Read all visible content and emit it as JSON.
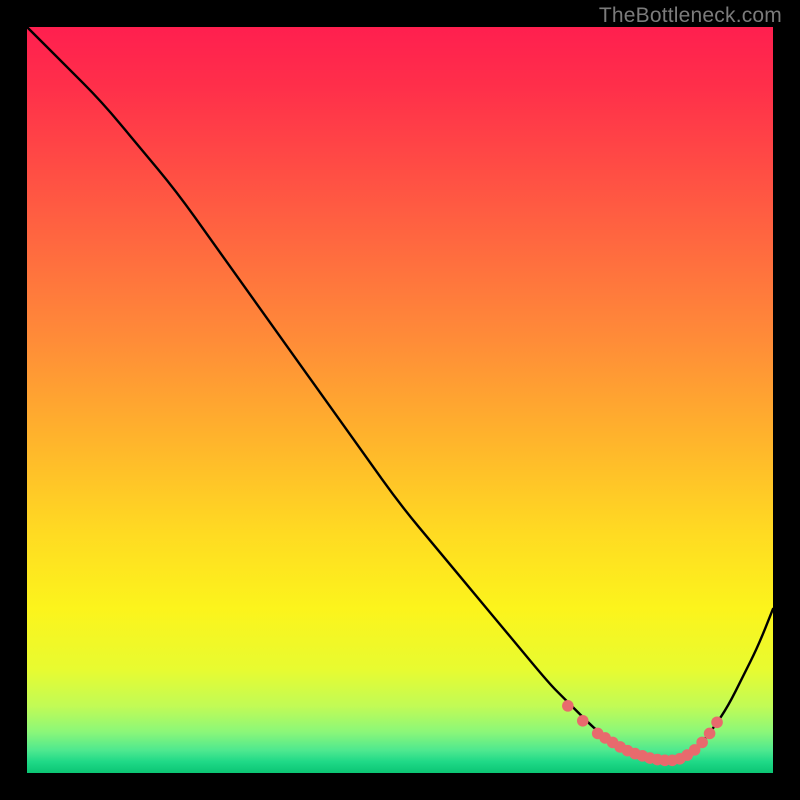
{
  "watermark": "TheBottleneck.com",
  "chart_data": {
    "type": "line",
    "title": "",
    "xlabel": "",
    "ylabel": "",
    "xlim": [
      0,
      100
    ],
    "ylim": [
      0,
      100
    ],
    "grid": false,
    "legend": false,
    "series": [
      {
        "name": "bottleneck-curve",
        "x": [
          0,
          5,
          10,
          15,
          20,
          25,
          30,
          35,
          40,
          45,
          50,
          55,
          60,
          65,
          70,
          72,
          74,
          76,
          78,
          80,
          82,
          84,
          86,
          88,
          90,
          92,
          94,
          96,
          98,
          100
        ],
        "y": [
          100,
          95,
          90,
          84,
          78,
          71,
          64,
          57,
          50,
          43,
          36,
          30,
          24,
          18,
          12,
          10,
          8,
          6,
          4.5,
          3.2,
          2.3,
          1.8,
          1.7,
          2.2,
          3.5,
          6,
          9,
          13,
          17,
          22
        ]
      }
    ],
    "markers": {
      "name": "optimum-band",
      "x": [
        72.5,
        74.5,
        76.5,
        77.5,
        78.5,
        79.5,
        80.5,
        81.5,
        82.5,
        83.5,
        84.5,
        85.5,
        86.5,
        87.5,
        88.5,
        89.5,
        90.5,
        91.5,
        92.5
      ],
      "y": [
        9.0,
        7.0,
        5.3,
        4.7,
        4.1,
        3.5,
        3.0,
        2.6,
        2.3,
        2.0,
        1.8,
        1.7,
        1.7,
        1.9,
        2.4,
        3.1,
        4.1,
        5.3,
        6.8
      ]
    },
    "gradient_stops": [
      {
        "offset": 0.0,
        "color": "#ff1f4f"
      },
      {
        "offset": 0.08,
        "color": "#ff2f4a"
      },
      {
        "offset": 0.18,
        "color": "#ff4a45"
      },
      {
        "offset": 0.3,
        "color": "#ff6b3f"
      },
      {
        "offset": 0.42,
        "color": "#ff8c38"
      },
      {
        "offset": 0.55,
        "color": "#ffb32c"
      },
      {
        "offset": 0.68,
        "color": "#ffdb22"
      },
      {
        "offset": 0.78,
        "color": "#fcf41c"
      },
      {
        "offset": 0.86,
        "color": "#e8fb30"
      },
      {
        "offset": 0.91,
        "color": "#c2fb55"
      },
      {
        "offset": 0.945,
        "color": "#8bf779"
      },
      {
        "offset": 0.97,
        "color": "#4de88f"
      },
      {
        "offset": 0.985,
        "color": "#1fd987"
      },
      {
        "offset": 1.0,
        "color": "#0bc574"
      }
    ],
    "marker_color": "#e86a6d",
    "curve_color": "#000000"
  }
}
